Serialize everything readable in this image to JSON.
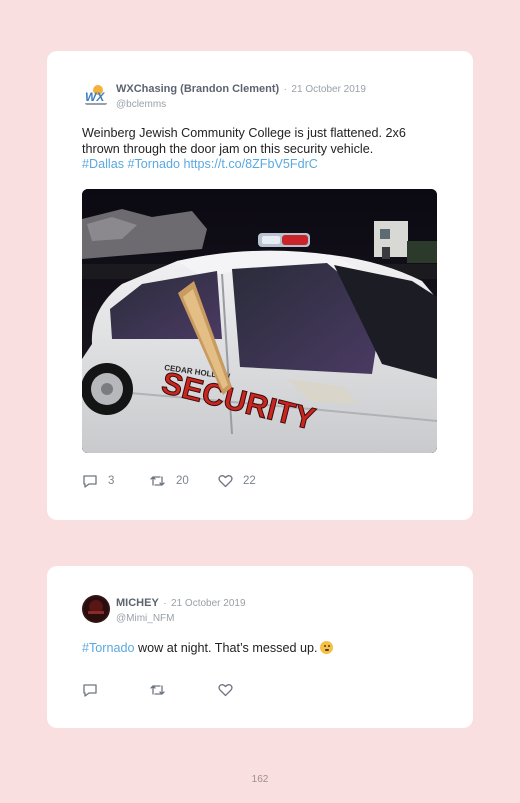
{
  "tweets": [
    {
      "display_name": "WXChasing (Brandon Clement)",
      "separator": "·",
      "date": "21 October 2019",
      "handle": "@bclemms",
      "text": "Weinberg Jewish Community College is just flattened. 2x6 thrown through the door jam on this security vehicle.",
      "hashtags": [
        "#Dallas",
        "#Tornado"
      ],
      "link": "https://t.co/8ZFbV5FdrC",
      "media": {
        "vehicle_text_top": "CEDAR HOLLOW",
        "vehicle_text_main": "SECURITY",
        "colors": {
          "door_text": "#c8261f",
          "car_body": "#e9eaec",
          "sky": "#0d0b14"
        }
      },
      "actions": {
        "replies": "3",
        "retweets": "20",
        "likes": "22"
      }
    },
    {
      "display_name": "MICHEY",
      "separator": "·",
      "date": "21 October 2019",
      "handle": "@Mimi_NFM",
      "hashtag": "#Tornado",
      "text": " wow at night. That’s messed up.",
      "emoji": "confused-face"
    }
  ],
  "page_number": "162",
  "colors": {
    "page_bg": "#f9dfe0",
    "card_bg": "#ffffff",
    "link": "#5aa9e0",
    "meta": "#9aa0a8"
  }
}
